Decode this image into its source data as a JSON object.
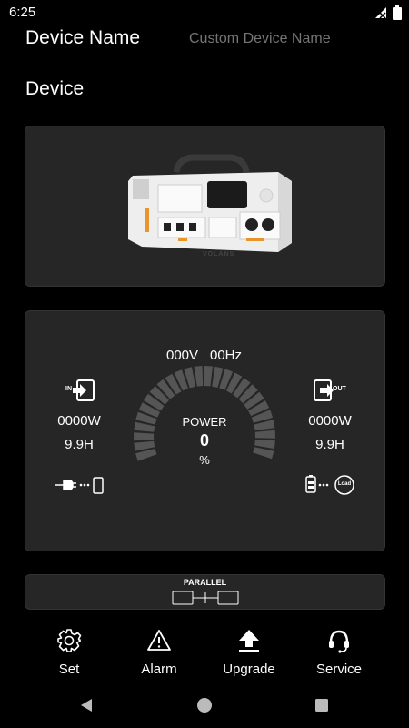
{
  "status": {
    "time": "6:25"
  },
  "header": {
    "label": "Device Name",
    "placeholder": "Custom Device Name"
  },
  "section": {
    "device": "Device"
  },
  "device_image": {
    "brand": "VOLANS"
  },
  "power": {
    "voltage": "000V",
    "frequency": "00Hz",
    "label": "POWER",
    "value": "0",
    "unit": "%",
    "input": {
      "badge": "IN",
      "watts": "0000W",
      "hours": "9.9H"
    },
    "output": {
      "badge": "OUT",
      "watts": "0000W",
      "hours": "9.9H",
      "load": "Load"
    }
  },
  "parallel": {
    "label": "PARALLEL"
  },
  "bottom_nav": [
    {
      "label": "Set",
      "icon": "gear-icon"
    },
    {
      "label": "Alarm",
      "icon": "alarm-icon"
    },
    {
      "label": "Upgrade",
      "icon": "upload-icon"
    },
    {
      "label": "Service",
      "icon": "headset-icon"
    }
  ],
  "colors": {
    "background": "#000000",
    "card": "#262626",
    "accent_orange": "#e8952e"
  }
}
